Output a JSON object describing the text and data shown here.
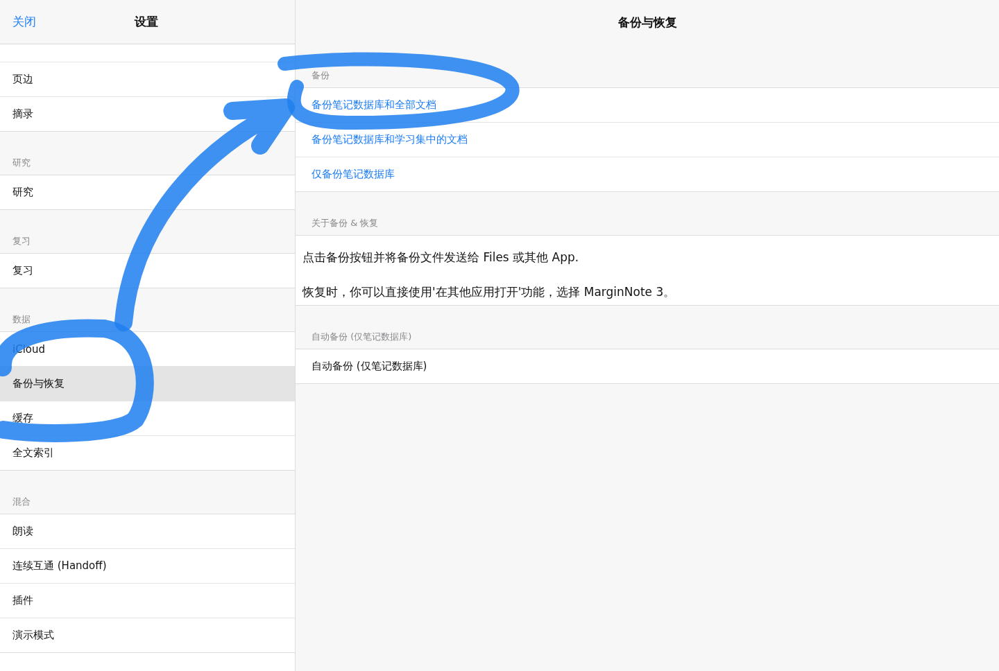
{
  "sidebar": {
    "close_button": "关闭",
    "title": "设置",
    "sections": [
      {
        "items": [
          {
            "label": "页边",
            "selected": false
          },
          {
            "label": "摘录",
            "selected": false
          }
        ]
      },
      {
        "title": "研究",
        "items": [
          {
            "label": "研究",
            "selected": false
          }
        ]
      },
      {
        "title": "复习",
        "items": [
          {
            "label": "复习",
            "selected": false
          }
        ]
      },
      {
        "title": "数据",
        "items": [
          {
            "label": "iCloud",
            "selected": false
          },
          {
            "label": "备份与恢复",
            "selected": true
          },
          {
            "label": "缓存",
            "selected": false
          },
          {
            "label": "全文索引",
            "selected": false
          }
        ]
      },
      {
        "title": "混合",
        "items": [
          {
            "label": "朗读",
            "selected": false
          },
          {
            "label": "连续互通 (Handoff)",
            "selected": false
          },
          {
            "label": "插件",
            "selected": false
          },
          {
            "label": "演示模式",
            "selected": false
          }
        ]
      }
    ]
  },
  "detail": {
    "title": "备份与恢复",
    "sections": [
      {
        "title": "备份",
        "kind": "links",
        "items": [
          "备份笔记数据库和全部文档",
          "备份笔记数据库和学习集中的文档",
          "仅备份笔记数据库"
        ]
      },
      {
        "title": "关于备份 & 恢复",
        "kind": "text",
        "items": [
          "点击备份按钮并将备份文件发送给 Files 或其他 App.",
          "恢复时，你可以直接使用'在其他应用打开'功能，选择 MarginNote 3。"
        ]
      },
      {
        "title": "自动备份 (仅笔记数据库)",
        "kind": "rows",
        "items": [
          "自动备份 (仅笔记数据库)"
        ]
      }
    ]
  }
}
